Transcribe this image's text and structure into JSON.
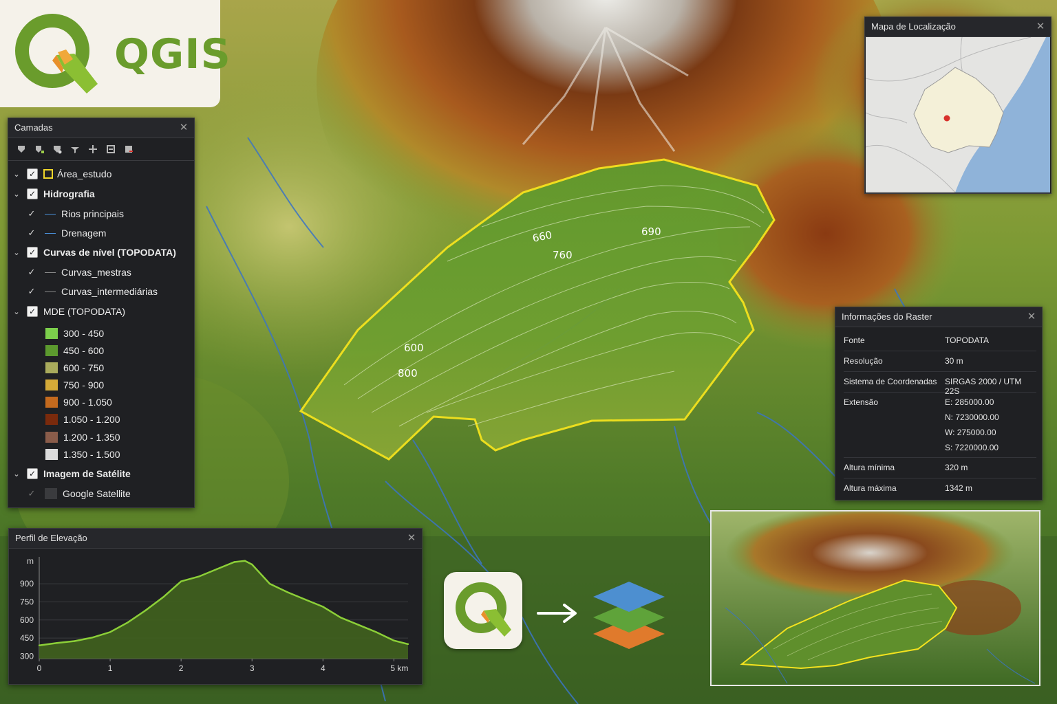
{
  "app": {
    "logo_text": "QGIS"
  },
  "map": {
    "contour_labels": [
      {
        "text": "660"
      },
      {
        "text": "690"
      },
      {
        "text": "760"
      },
      {
        "text": "600"
      },
      {
        "text": "800"
      }
    ],
    "study_area_color": "#f4e31e",
    "river_color": "#3b74c4"
  },
  "layers_panel": {
    "title": "Camadas",
    "toolbar_icons": [
      "open-layer-icon",
      "add-layer-icon",
      "add-group-icon",
      "filter-icon",
      "expand-all-icon",
      "collapse-all-icon",
      "remove-layer-icon"
    ],
    "items": [
      {
        "label": "Área_estudo",
        "type": "group",
        "checked": true,
        "symbol": "polygon"
      },
      {
        "label": "Hidrografia",
        "type": "group",
        "checked": true
      },
      {
        "label": "Rios principais",
        "type": "child",
        "checked": true,
        "symbol": "line-blue"
      },
      {
        "label": "Drenagem",
        "type": "child",
        "checked": true,
        "symbol": "line-blue"
      },
      {
        "label": "Curvas de nível (TOPODATA)",
        "type": "group",
        "checked": true
      },
      {
        "label": "Curvas_mestras",
        "type": "child",
        "checked": true,
        "symbol": "line-gray"
      },
      {
        "label": "Curvas_intermediárias",
        "type": "child",
        "checked": true,
        "symbol": "line-gray"
      },
      {
        "label": "MDE (TOPODATA)",
        "type": "group",
        "checked": true
      }
    ],
    "legend": [
      {
        "label": "300 - 450",
        "color": "#7ccf4c"
      },
      {
        "label": "450 - 600",
        "color": "#5c9a2e"
      },
      {
        "label": "600 - 750",
        "color": "#a9ab5c"
      },
      {
        "label": "750 - 900",
        "color": "#d4aa38"
      },
      {
        "label": "900 - 1.050",
        "color": "#c46a1e"
      },
      {
        "label": "1.050 - 1.200",
        "color": "#7a2a0c"
      },
      {
        "label": "1.200 - 1.350",
        "color": "#8a5c4a"
      },
      {
        "label": "1.350 - 1.500",
        "color": "#dcdcdc"
      }
    ],
    "satellite_group": {
      "label": "Imagem de Satélite",
      "checked": true
    },
    "satellite_child": {
      "label": "Google Satellite",
      "checked": false
    }
  },
  "location_map": {
    "title": "Mapa de Localização",
    "land_color": "#e4e4e2",
    "sea_color": "#8fb3d9",
    "region_color": "#f4f0d8",
    "point_color": "#d8322b"
  },
  "raster_info": {
    "title": "Informações do Raster",
    "rows": [
      {
        "key": "Fonte",
        "value": "TOPODATA"
      },
      {
        "key": "Resolução",
        "value": "30 m"
      },
      {
        "key": "Sistema de Coordenadas",
        "value": "SIRGAS 2000 / UTM 22S"
      },
      {
        "key": "Extensão",
        "value": "E:  285000.00"
      },
      {
        "key": "",
        "value": "N:  7230000.00"
      },
      {
        "key": "",
        "value": "W:  275000.00"
      },
      {
        "key": "",
        "value": "S:  7220000.00"
      },
      {
        "key": "Altura mínima",
        "value": "320 m"
      },
      {
        "key": "Altura máxima",
        "value": "1342 m"
      }
    ]
  },
  "profile": {
    "title": "Perfil de Elevação"
  },
  "chart_data": {
    "type": "area",
    "x": [
      0,
      0.25,
      0.5,
      0.75,
      1.0,
      1.25,
      1.5,
      1.75,
      2.0,
      2.25,
      2.5,
      2.75,
      2.9,
      3.0,
      3.25,
      3.5,
      3.75,
      4.0,
      4.25,
      4.5,
      4.75,
      5.0,
      5.2
    ],
    "y": [
      390,
      410,
      425,
      455,
      500,
      580,
      680,
      790,
      920,
      960,
      1020,
      1080,
      1090,
      1060,
      900,
      830,
      770,
      710,
      620,
      560,
      500,
      430,
      400
    ],
    "xlim": [
      0,
      5.2
    ],
    "ylim": [
      280,
      1100
    ],
    "xticks": [
      "0",
      "1",
      "2",
      "3",
      "4",
      "5 km"
    ],
    "yticks": [
      "300",
      "450",
      "600",
      "750",
      "900"
    ],
    "ylabel": "m",
    "fill_color": "#3f5f1f",
    "line_color": "#8ccf38"
  }
}
